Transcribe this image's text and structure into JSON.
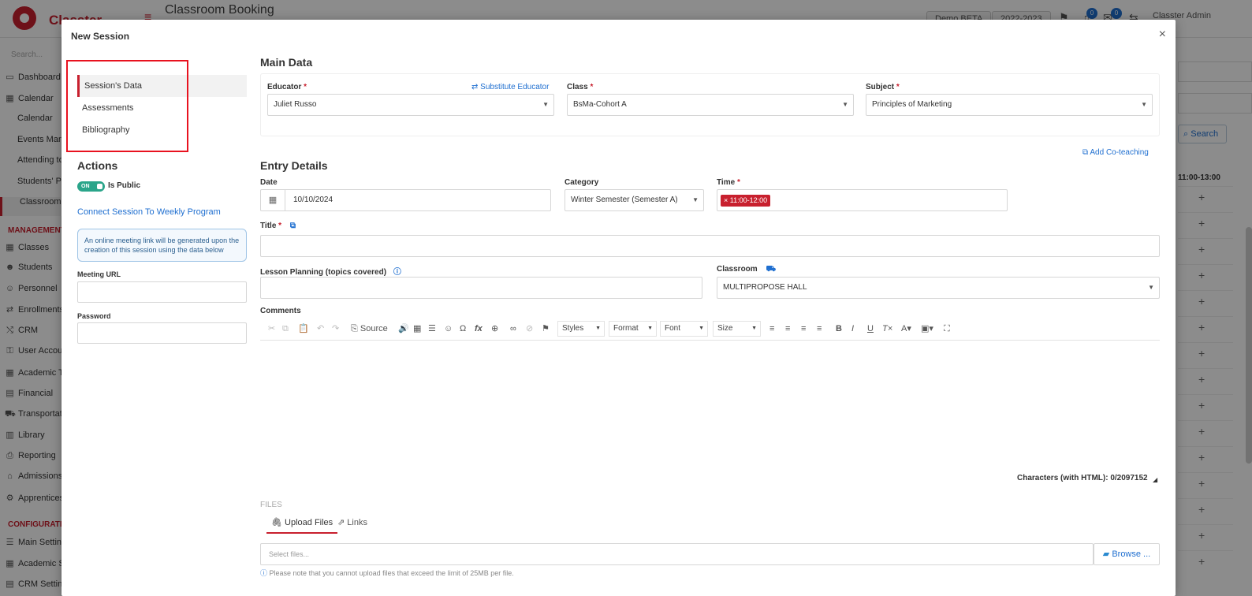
{
  "background": {
    "logo_text": "Classter",
    "page_title": "Classroom Booking",
    "search_placeholder": "Search...",
    "demo_badge": "Demo BETA",
    "year_select": "2022-2023",
    "notif_count_1": "0",
    "notif_count_2": "0",
    "user_name": "Classter Admin",
    "nav": [
      {
        "label": "Dashboard",
        "icon": "dashboard-icon",
        "glyph": "▭"
      },
      {
        "label": "Calendar",
        "icon": "calendar-icon",
        "glyph": "▦"
      },
      {
        "label": "Calendar",
        "icon": "",
        "glyph": ""
      },
      {
        "label": "Events Management",
        "icon": "",
        "glyph": ""
      },
      {
        "label": "Attending to",
        "icon": "",
        "glyph": ""
      },
      {
        "label": "Students' Presence",
        "icon": "",
        "glyph": ""
      },
      {
        "label": "Classroom Booking",
        "icon": "",
        "glyph": ""
      }
    ],
    "management_label": "MANAGEMENT",
    "management_nav": [
      {
        "label": "Classes",
        "glyph": "▦"
      },
      {
        "label": "Students",
        "glyph": "☻"
      },
      {
        "label": "Personnel",
        "glyph": "☺"
      },
      {
        "label": "Enrollments",
        "glyph": "⇄"
      },
      {
        "label": "CRM",
        "glyph": "⤭"
      },
      {
        "label": "User Accounts",
        "glyph": "⚿"
      },
      {
        "label": "Academic Terms",
        "glyph": "▦"
      },
      {
        "label": "Financial",
        "glyph": "▤"
      },
      {
        "label": "Transportation",
        "glyph": "⛟"
      },
      {
        "label": "Library",
        "glyph": "▥"
      },
      {
        "label": "Reporting",
        "glyph": "⎙"
      },
      {
        "label": "Admissions",
        "glyph": "⌂"
      },
      {
        "label": "Apprenticeships",
        "glyph": "⚙"
      }
    ],
    "configuration_label": "CONFIGURATION",
    "configuration_nav": [
      {
        "label": "Main Settings",
        "glyph": "☰"
      },
      {
        "label": "Academic Settings",
        "glyph": "▦"
      },
      {
        "label": "CRM Settings",
        "glyph": "▤"
      }
    ],
    "search_button": "Search",
    "hour_header": "11:00-13:00"
  },
  "modal": {
    "title": "New Session",
    "close_icon": "×",
    "left_nav": [
      "Session's Data",
      "Assessments",
      "Bibliography"
    ],
    "actions_title": "Actions",
    "toggle_state": "ON",
    "toggle_label": "Is Public",
    "connect_link": "Connect Session To Weekly Program",
    "info_text": "An online meeting link will be generated upon the creation of this session using the data below",
    "meeting_url_label": "Meeting URL",
    "meeting_url_value": "",
    "password_label": "Password",
    "password_value": ""
  },
  "main_data": {
    "title": "Main Data",
    "educator_label": "Educator",
    "educator_value": "Juliet Russo",
    "substitute_link": "Substitute Educator",
    "class_label": "Class",
    "class_value": "BsMa-Cohort A",
    "subject_label": "Subject",
    "subject_value": "Principles of Marketing",
    "co_teaching_link": "Add Co-teaching"
  },
  "entry": {
    "title": "Entry Details",
    "date_label": "Date",
    "date_value": "10/10/2024",
    "category_label": "Category",
    "category_value": "Winter Semester (Semester A)",
    "time_label": "Time",
    "time_tag": "11:00-12:00",
    "title_label": "Title",
    "title_value": "",
    "lesson_label": "Lesson Planning (topics covered)",
    "lesson_value": "",
    "classroom_label": "Classroom",
    "classroom_value": "MULTIPROPOSE HALL",
    "comments_label": "Comments"
  },
  "editor": {
    "source_label": "Source",
    "styles_label": "Styles",
    "format_label": "Format",
    "font_label": "Font",
    "size_label": "Size",
    "char_count": "Characters (with HTML): 0/2097152"
  },
  "files": {
    "section_label": "FILES",
    "upload_tab": "Upload Files",
    "links_tab": "Links",
    "select_placeholder": "Select files...",
    "browse_label": "Browse ...",
    "note": "Please note that you cannot upload files that exceed the limit of 25MB per file."
  },
  "colors": {
    "accent": "#c8202e",
    "link": "#1f6fd0",
    "toggle_on": "#2aa58a",
    "highlight": "#e8121f"
  }
}
